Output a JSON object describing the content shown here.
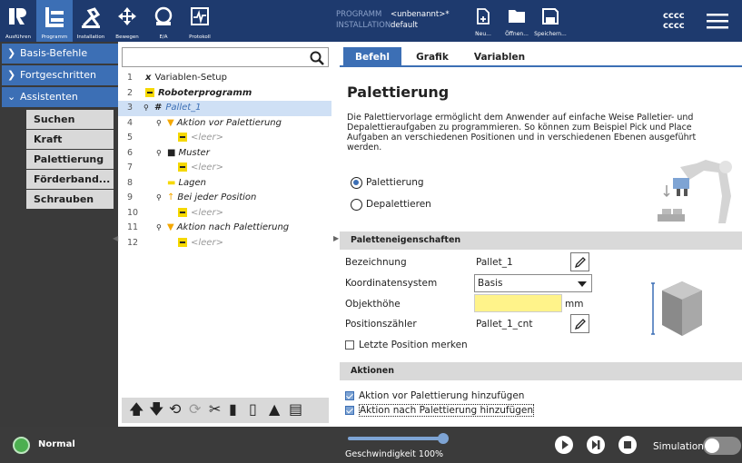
{
  "topbar": {
    "buttons": [
      {
        "label": "Ausführen",
        "icon": "ur-logo-icon"
      },
      {
        "label": "Programm",
        "icon": "program-icon"
      },
      {
        "label": "Installation",
        "icon": "installation-icon"
      },
      {
        "label": "Bewegen",
        "icon": "move-icon"
      },
      {
        "label": "E/A",
        "icon": "io-icon"
      },
      {
        "label": "Protokoll",
        "icon": "log-icon"
      }
    ],
    "program_key": "PROGRAMM",
    "program_val": "<unbenannt>*",
    "installation_key": "INSTALLATION",
    "installation_val": "default",
    "file_buttons": [
      {
        "label": "Neu..."
      },
      {
        "label": "Öffnen..."
      },
      {
        "label": "Speichern..."
      }
    ],
    "user_line1": "cccc",
    "user_line2": "cccc"
  },
  "sidebar": {
    "categories": [
      "Basis-Befehle",
      "Fortgeschritten",
      "Assistenten"
    ],
    "items": [
      "Suchen",
      "Kraft",
      "Palettierung",
      "Förderband...",
      "Schrauben"
    ]
  },
  "tree": {
    "rows": [
      {
        "num": "1",
        "text": "Variablen-Setup"
      },
      {
        "num": "2",
        "text": "Roboterprogramm"
      },
      {
        "num": "3",
        "text": "Pallet_1"
      },
      {
        "num": "4",
        "text": "Aktion vor Palettierung"
      },
      {
        "num": "5",
        "text": "<leer>"
      },
      {
        "num": "6",
        "text": "Muster"
      },
      {
        "num": "7",
        "text": "<leer>"
      },
      {
        "num": "8",
        "text": "Lagen"
      },
      {
        "num": "9",
        "text": "Bei jeder Position"
      },
      {
        "num": "10",
        "text": "<leer>"
      },
      {
        "num": "11",
        "text": "Aktion nach Palettierung"
      },
      {
        "num": "12",
        "text": "<leer>"
      }
    ]
  },
  "main": {
    "tabs": [
      "Befehl",
      "Grafik",
      "Variablen"
    ],
    "title": "Palettierung",
    "description": "Die Palettiervorlage ermöglicht dem Anwender auf einfache Weise Palletier- und Depalettieraufgaben zu programmieren. So können zum Beispiel Pick und Place Aufgaben an verschiedenen Positionen und in verschiedenen Ebenen ausgeführt werden.",
    "radio_palletize": "Palettierung",
    "radio_depalletize": "Depalettieren",
    "section_props": "Paletteneigenschaften",
    "props": {
      "name_label": "Bezeichnung",
      "name_value": "Pallet_1",
      "coord_label": "Koordinatensystem",
      "coord_value": "Basis",
      "height_label": "Objekthöhe",
      "height_unit": "mm",
      "counter_label": "Positionszähler",
      "counter_value": "Pallet_1_cnt",
      "remember_label": "Letzte Position merken"
    },
    "section_actions": "Aktionen",
    "actions": {
      "before": "Aktion vor Palettierung hinzufügen",
      "after": "Aktion nach Palettierung hinzufügen"
    }
  },
  "footer": {
    "status": "Normal",
    "speed": "Geschwindigkeit 100%",
    "speed_fraction": 1.0,
    "simulation": "Simulation"
  }
}
